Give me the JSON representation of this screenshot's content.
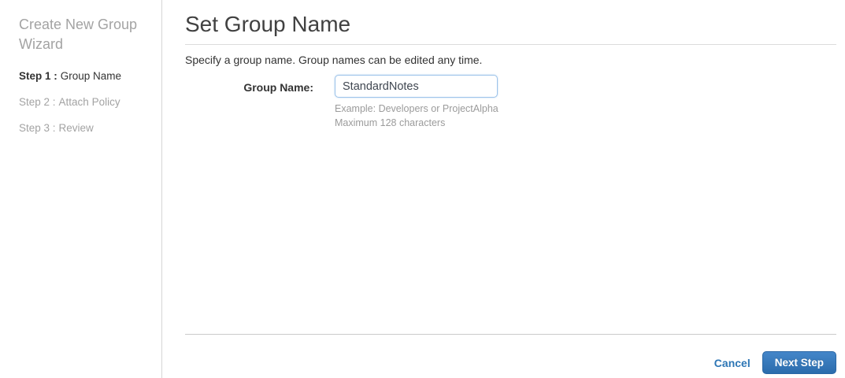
{
  "sidebar": {
    "title": "Create New Group Wizard",
    "steps": [
      {
        "prefix": "Step 1 :",
        "label": "Group Name"
      },
      {
        "prefix": "Step 2 :",
        "label": "Attach Policy"
      },
      {
        "prefix": "Step 3 :",
        "label": "Review"
      }
    ],
    "active_step_index": 0
  },
  "main": {
    "title": "Set Group Name",
    "description": "Specify a group name. Group names can be edited any time.",
    "form": {
      "label": "Group Name:",
      "value": "StandardNotes",
      "help_line1": "Example: Developers or ProjectAlpha",
      "help_line2": "Maximum 128 characters"
    },
    "footer": {
      "cancel_label": "Cancel",
      "next_label": "Next Step"
    }
  },
  "colors": {
    "accent_blue": "#2d76b5",
    "button_gradient_top": "#4486c9",
    "button_gradient_bottom": "#2b6cac",
    "input_focus_border": "#9cc3ea",
    "inactive_text": "#a3a3a3"
  }
}
